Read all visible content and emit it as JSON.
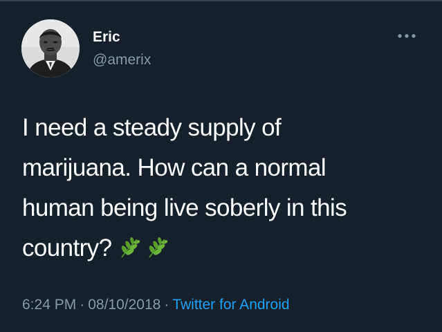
{
  "tweet": {
    "author": {
      "display_name": "Eric",
      "handle": "@amerix",
      "avatar_icon": "portrait-avatar"
    },
    "more_icon": "more-horizontal-icon",
    "text_lines": [
      "I need a steady supply of",
      "marijuana. How can a normal",
      "human being live soberly in this",
      "country?"
    ],
    "emoji": [
      "herb-emoji",
      "herb-emoji"
    ],
    "time": "6:24 PM",
    "separator": "·",
    "date": "08/10/2018",
    "source": "Twitter for Android"
  },
  "colors": {
    "background": "#15202b",
    "text": "#ffffff",
    "secondary_text": "#8899a6",
    "link": "#1da1f2",
    "divider": "#38444d",
    "herb": "#5a9e2f"
  }
}
